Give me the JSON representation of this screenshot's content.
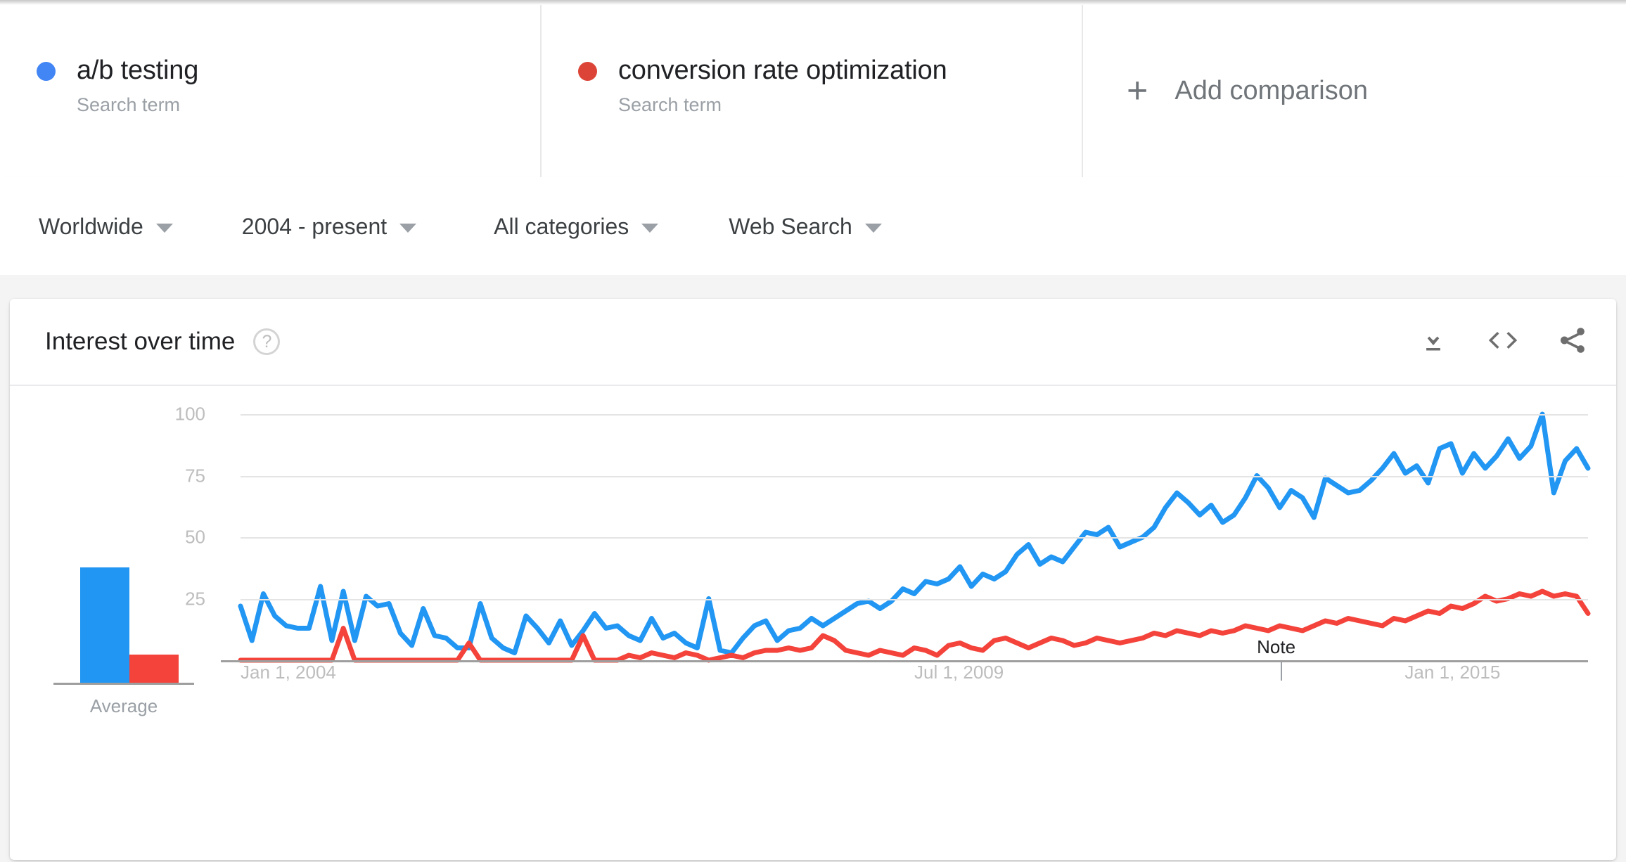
{
  "terms": [
    {
      "label": "a/b testing",
      "sublabel": "Search term",
      "color": "#4285f4",
      "dot_icon": "legend-dot-blue"
    },
    {
      "label": "conversion rate optimization",
      "sublabel": "Search term",
      "color": "#db4437",
      "dot_icon": "legend-dot-red"
    }
  ],
  "add_comparison": {
    "label": "Add comparison",
    "plus": "+",
    "icon": "plus-icon"
  },
  "filters": [
    {
      "name": "location",
      "value": "Worldwide"
    },
    {
      "name": "time-range",
      "value": "2004 - present"
    },
    {
      "name": "category",
      "value": "All categories"
    },
    {
      "name": "search-type",
      "value": "Web Search"
    }
  ],
  "card": {
    "title": "Interest over time",
    "help": "?",
    "actions": [
      {
        "name": "download-csv-icon",
        "tooltip": "Download"
      },
      {
        "name": "embed-code-icon",
        "tooltip": "Embed"
      },
      {
        "name": "share-icon",
        "tooltip": "Share"
      }
    ]
  },
  "average_panel": {
    "caption": "Average",
    "values": [
      41,
      10
    ],
    "colors": [
      "#2196f3",
      "#f4433b"
    ]
  },
  "chart_data": {
    "type": "line",
    "title": "Interest over time",
    "xlabel": "",
    "ylabel": "",
    "ylim": [
      0,
      100
    ],
    "yticks": [
      25,
      50,
      75,
      100
    ],
    "grid": true,
    "legend_position": "top",
    "xtick_labels": [
      "Jan 1, 2004",
      "Jul 1, 2009",
      "Jan 1, 2015"
    ],
    "xtick_positions": [
      0,
      0.5,
      0.864
    ],
    "annotations": [
      {
        "label": "Note",
        "x": 0.772
      }
    ],
    "series": [
      {
        "name": "a/b testing",
        "color": "#2196f3",
        "values": [
          22,
          8,
          27,
          18,
          14,
          13,
          13,
          30,
          8,
          28,
          8,
          26,
          22,
          23,
          11,
          6,
          21,
          10,
          9,
          5,
          5,
          23,
          9,
          5,
          3,
          18,
          13,
          7,
          16,
          6,
          12,
          19,
          13,
          14,
          10,
          8,
          17,
          9,
          11,
          7,
          5,
          25,
          4,
          3,
          9,
          14,
          16,
          8,
          12,
          13,
          17,
          14,
          17,
          20,
          23,
          24,
          21,
          24,
          29,
          27,
          32,
          31,
          33,
          38,
          30,
          35,
          33,
          36,
          43,
          47,
          39,
          42,
          40,
          46,
          52,
          51,
          54,
          46,
          48,
          50,
          54,
          62,
          68,
          64,
          59,
          63,
          56,
          59,
          66,
          75,
          70,
          62,
          69,
          66,
          58,
          74,
          71,
          68,
          69,
          73,
          78,
          84,
          76,
          79,
          72,
          86,
          88,
          76,
          84,
          78,
          83,
          90,
          82,
          87,
          100,
          68,
          81,
          86,
          78
        ]
      },
      {
        "name": "conversion rate optimization",
        "color": "#f4433b",
        "values": [
          0,
          0,
          0,
          0,
          0,
          0,
          0,
          0,
          0,
          13,
          0,
          0,
          0,
          0,
          0,
          0,
          0,
          0,
          0,
          0,
          7,
          0,
          0,
          0,
          0,
          0,
          0,
          0,
          0,
          0,
          10,
          0,
          0,
          0,
          2,
          1,
          3,
          2,
          1,
          3,
          2,
          0,
          1,
          2,
          1,
          3,
          4,
          4,
          5,
          4,
          5,
          10,
          8,
          4,
          3,
          2,
          4,
          3,
          2,
          5,
          4,
          2,
          6,
          7,
          5,
          4,
          8,
          9,
          7,
          5,
          7,
          9,
          8,
          6,
          7,
          9,
          8,
          7,
          8,
          9,
          11,
          10,
          12,
          11,
          10,
          12,
          11,
          12,
          14,
          13,
          12,
          14,
          13,
          12,
          14,
          16,
          15,
          17,
          16,
          15,
          14,
          17,
          16,
          18,
          20,
          19,
          22,
          21,
          23,
          26,
          24,
          25,
          27,
          26,
          28,
          26,
          27,
          26,
          19
        ]
      }
    ]
  }
}
